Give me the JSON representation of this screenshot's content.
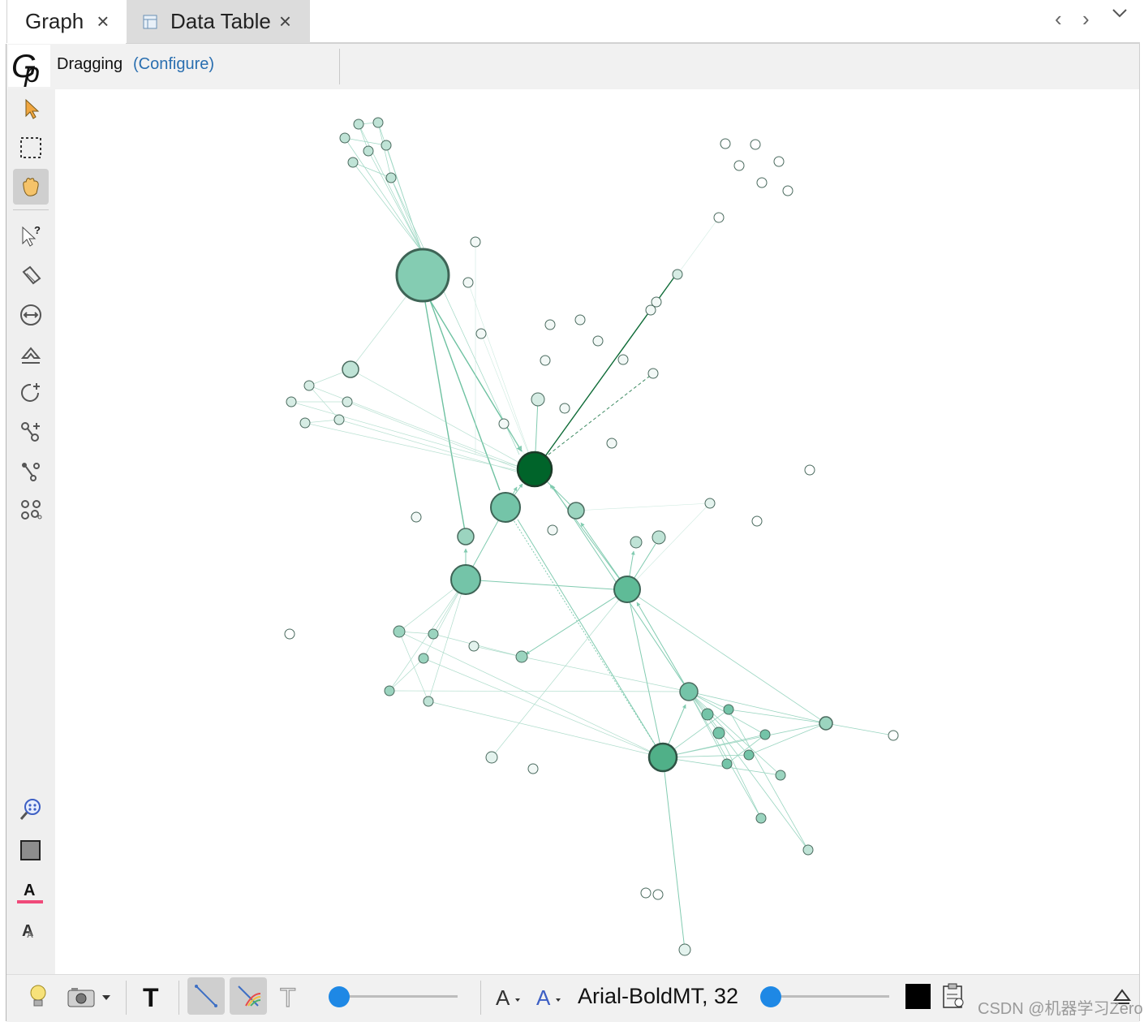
{
  "tabs": [
    {
      "label": "Graph",
      "close": "×"
    },
    {
      "label": "Data Table",
      "close": "×"
    }
  ],
  "nav": {
    "prev": "‹",
    "next": "›",
    "menu": "⌄"
  },
  "toolbar": {
    "mode_label": "Dragging",
    "configure_label": "(Configure)"
  },
  "left_tools": [
    "pointer-icon",
    "rectangle-select-icon",
    "drag-hand-icon",
    "info-pointer-icon",
    "painter-icon",
    "resize-icon",
    "sizer-icon",
    "brush-icon",
    "add-node-icon",
    "edge-pencil-icon",
    "shortest-path-icon",
    "heatmap-icon"
  ],
  "left_bottom_tools": [
    "zoom-magnifier-icon",
    "background-color-icon",
    "label-color-icon",
    "label-size-icon"
  ],
  "bottom_toolbar": {
    "font_label": "Arial-BoldMT, 32",
    "edge_color": "#000000",
    "node_label_slider": 0.05,
    "edge_label_slider": 0.05
  },
  "watermark": "CSDN @机器学习Zero",
  "colors": {
    "accent": "#1e88e5",
    "node_light": "#d6ece4",
    "node_mid": "#7fcab0",
    "node_dark": "#00642a",
    "edge": "#6cc2a3"
  }
}
